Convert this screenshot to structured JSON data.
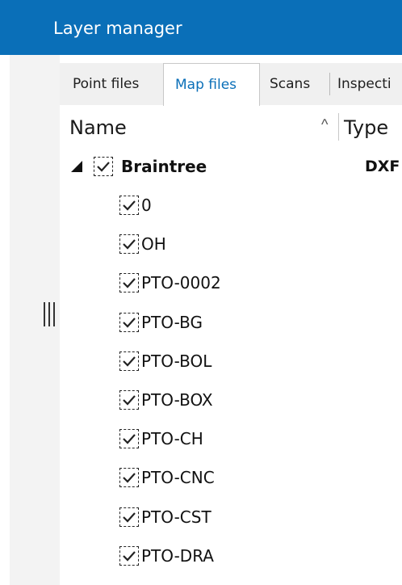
{
  "window": {
    "title": "Layer manager"
  },
  "tabs": [
    {
      "label": "Point files",
      "active": false
    },
    {
      "label": "Map files",
      "active": true
    },
    {
      "label": "Scans",
      "active": false
    },
    {
      "label": "Inspecti",
      "active": false
    }
  ],
  "columns": {
    "name": "Name",
    "type": "Type",
    "sort_indicator": "^"
  },
  "tree": {
    "group": {
      "name": "Braintree",
      "type": "DXF",
      "checked": true,
      "expanded": true
    },
    "layers": [
      {
        "name": "0",
        "checked": true
      },
      {
        "name": "OH",
        "checked": true
      },
      {
        "name": "PTO-0002",
        "checked": true
      },
      {
        "name": "PTO-BG",
        "checked": true
      },
      {
        "name": "PTO-BOL",
        "checked": true
      },
      {
        "name": "PTO-BOX",
        "checked": true
      },
      {
        "name": "PTO-CH",
        "checked": true
      },
      {
        "name": "PTO-CNC",
        "checked": true
      },
      {
        "name": "PTO-CST",
        "checked": true
      },
      {
        "name": "PTO-DRA",
        "checked": true
      }
    ]
  },
  "icons": {
    "grip": "drag-handle-icon",
    "check": "checkmark-icon",
    "expander": "expanded-triangle-icon"
  },
  "colors": {
    "accent": "#0a6fb8",
    "titlebar": "#0a6fb8"
  }
}
